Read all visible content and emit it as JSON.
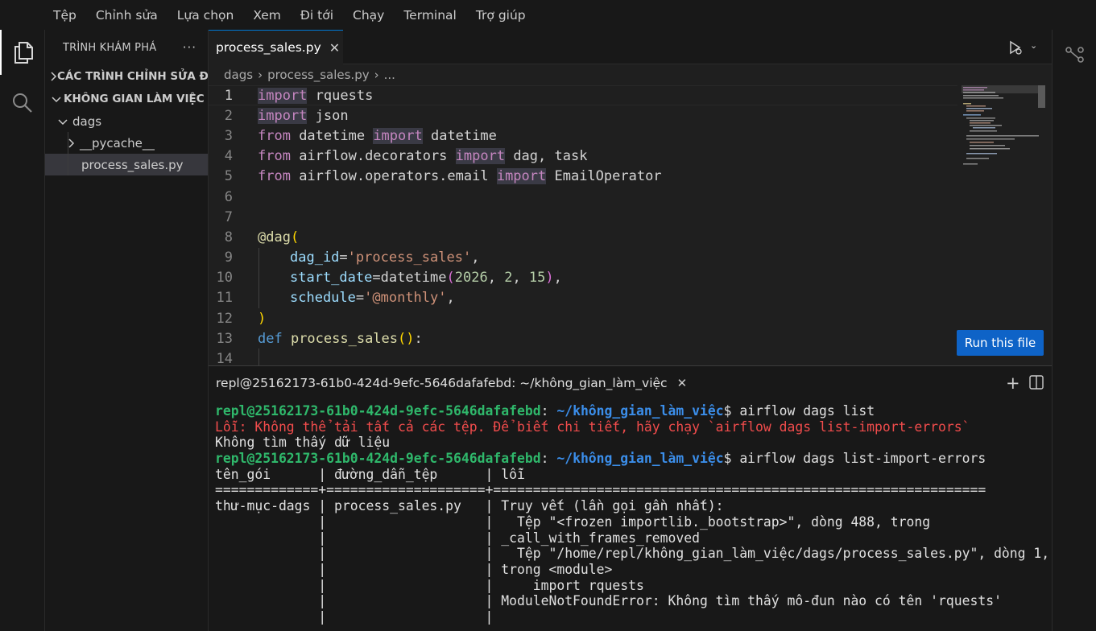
{
  "menu": [
    "Tệp",
    "Chỉnh sửa",
    "Lựa chọn",
    "Xem",
    "Đi tới",
    "Chạy",
    "Terminal",
    "Trợ giúp"
  ],
  "sidebar": {
    "title": "TRÌNH KHÁM PHÁ",
    "more": "···",
    "open_editors": "CÁC TRÌNH CHỈNH SỬA ĐANG MỞ",
    "workspace": "KHÔNG GIAN LÀM VIỆC",
    "folder": "dags",
    "subfolder": "__pycache__",
    "file": "process_sales.py"
  },
  "editor": {
    "tab_label": "process_sales.py",
    "tab_close": "✕",
    "breadcrumb": [
      "dags",
      "process_sales.py",
      "..."
    ],
    "line_numbers": [
      "1",
      "2",
      "3",
      "4",
      "5",
      "6",
      "7",
      "8",
      "9",
      "10",
      "11",
      "12",
      "13",
      "14"
    ],
    "run_button": "Run this file",
    "code": {
      "l1": {
        "kw": "import",
        "rest": " rquests"
      },
      "l2": {
        "kw": "import",
        "rest": " json"
      },
      "l3": {
        "from": "from",
        "mod": " datetime ",
        "kw": "import",
        "rest": " datetime"
      },
      "l4": {
        "from": "from",
        "mod": " airflow.decorators ",
        "kw": "import",
        "rest": " dag, task"
      },
      "l5": {
        "from": "from",
        "mod": " airflow.operators.email ",
        "kw": "import",
        "rest": " EmailOperator"
      },
      "l8": {
        "dec": "@dag",
        "open": "("
      },
      "l9": {
        "param": "dag_id",
        "eq": "=",
        "str": "'process_sales'",
        "comma": ","
      },
      "l10": {
        "param": "start_date",
        "eq": "=",
        "fn": "datetime",
        "open": "(",
        "n1": "2026",
        "s1": ", ",
        "n2": "2",
        "s2": ", ",
        "n3": "15",
        "close": ")",
        "comma": ","
      },
      "l11": {
        "param": "schedule",
        "eq": "=",
        "str": "'@monthly'",
        "comma": ","
      },
      "l12": {
        "close": ")"
      },
      "l13": {
        "def": "def",
        "fn": " process_sales",
        "open": "(",
        "close": ")",
        "colon": ":"
      }
    }
  },
  "terminal": {
    "tab_label": "repl@25162173-61b0-424d-9efc-5646dafafebd: ~/không_gian_làm_việc",
    "tab_close": "✕",
    "plus": "+",
    "lines": {
      "p1_user": "repl@25162173-61b0-424d-9efc-5646dafafebd",
      "p1_colon": ":",
      "p1_path": " ~/không_gian_làm_việc",
      "p1_cmd": "$ airflow dags list",
      "err": "Lỗi: Không thể tải tất cả các tệp. Để biết chi tiết, hãy chạy `airflow dags list-import-errors`",
      "nodata": "Không tìm thấy dữ liệu",
      "p2_user": "repl@25162173-61b0-424d-9efc-5646dafafebd",
      "p2_colon": ":",
      "p2_path": " ~/không_gian_làm_việc",
      "p2_cmd": "$ airflow dags list-import-errors",
      "header": "tên_gói      | đường_dẫn_tệp      | lỗi",
      "rule": "=============+====================+==============================================================",
      "r1": "thư-mục-dags | process_sales.py   | Truy vết (lần gọi gần nhất):",
      "r2": "             |                    |   Tệp \"<frozen importlib._bootstrap>\", dòng 488, trong",
      "r3": "             |                    | _call_with_frames_removed",
      "r4": "             |                    |   Tệp \"/home/repl/không_gian_làm_việc/dags/process_sales.py\", dòng 1,",
      "r5": "             |                    | trong <module>",
      "r6": "             |                    |     import rquests",
      "r7": "             |                    | ModuleNotFoundError: Không tìm thấy mô-đun nào có tên 'rquests'",
      "r8": "             |                    |"
    }
  }
}
